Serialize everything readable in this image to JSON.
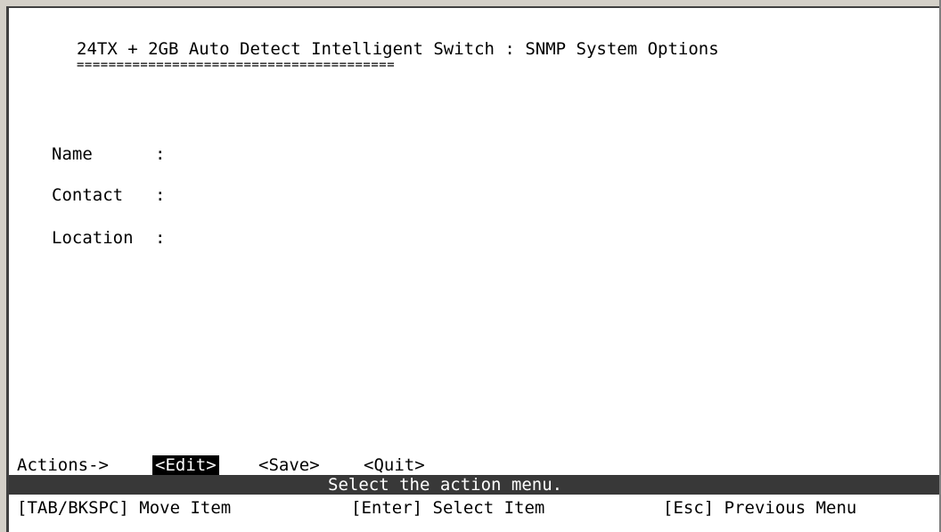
{
  "screen": {
    "title": "24TX + 2GB Auto Detect Intelligent Switch : SNMP System Options",
    "title_underline": "========================================"
  },
  "fields": [
    {
      "label": "Name",
      "separator": ":",
      "value": ""
    },
    {
      "label": "Contact",
      "separator": ":",
      "value": ""
    },
    {
      "label": "Location",
      "separator": ":",
      "value": ""
    }
  ],
  "actions": {
    "prefix": "Actions->",
    "items": [
      {
        "label": "<Edit>",
        "selected": true
      },
      {
        "label": "<Save>",
        "selected": false
      },
      {
        "label": "<Quit>",
        "selected": false
      }
    ]
  },
  "status": {
    "message": "Select the action menu."
  },
  "help": [
    "[TAB/BKSPC] Move Item",
    "[Enter] Select Item",
    "[Esc] Previous Menu"
  ],
  "colors": {
    "background": "#ffffff",
    "text": "#000000",
    "status_bar": "#383838",
    "highlight_bg": "#000000",
    "highlight_fg": "#ffffff"
  }
}
